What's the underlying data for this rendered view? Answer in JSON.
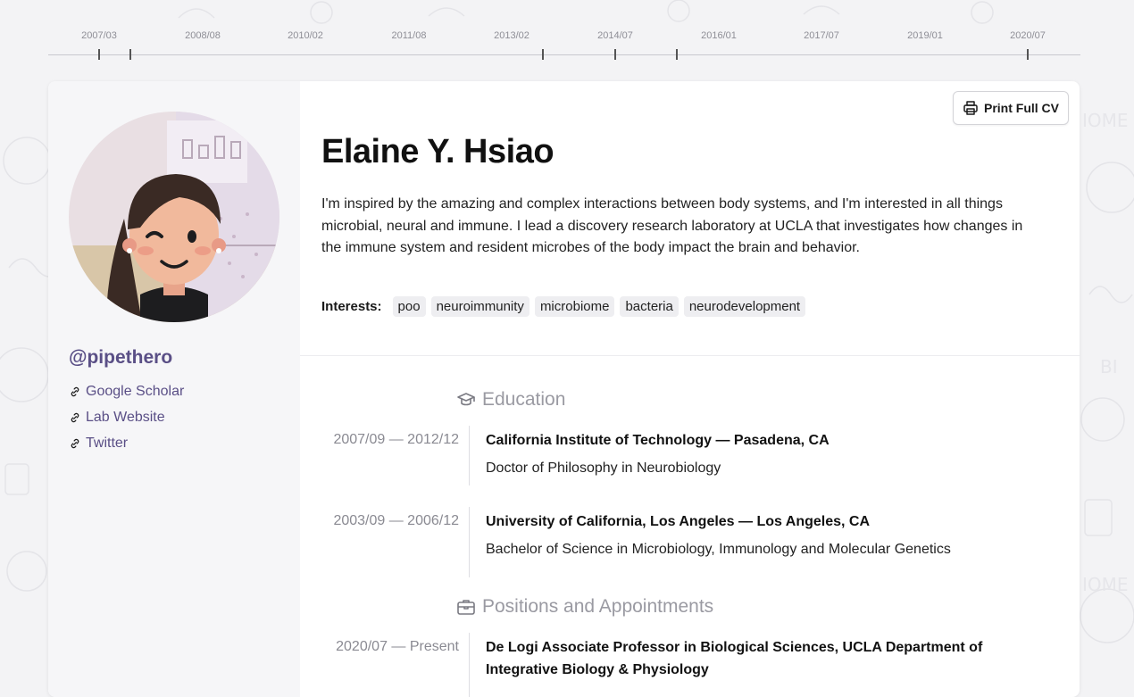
{
  "timeline": {
    "labels": [
      "2007/03",
      "2008/08",
      "2010/02",
      "2011/08",
      "2013/02",
      "2014/07",
      "2016/01",
      "2017/07",
      "2019/01",
      "2020/07"
    ]
  },
  "profile": {
    "handle": "@pipethero",
    "links": [
      {
        "label": "Google Scholar",
        "icon": "link-icon"
      },
      {
        "label": "Lab Website",
        "icon": "link-icon"
      },
      {
        "label": "Twitter",
        "icon": "link-icon"
      }
    ]
  },
  "header": {
    "print_label": "Print Full CV",
    "name": "Elaine Y. Hsiao",
    "bio": "I'm inspired by the amazing and complex interactions between body systems, and I'm interested in all things microbial, neural and immune. I lead a discovery research laboratory at UCLA that investigates how changes in the immune system and resident microbes of the body impact the brain and behavior.",
    "interests_label": "Interests:",
    "interests": [
      "poo",
      "neuroimmunity",
      "microbiome",
      "bacteria",
      "neurodevelopment"
    ]
  },
  "education": {
    "heading": "Education",
    "icon": "graduation-cap-icon",
    "entries": [
      {
        "date": "2007/09 — 2012/12",
        "title": "California Institute of Technology — Pasadena, CA",
        "sub": "Doctor of Philosophy in Neurobiology"
      },
      {
        "date": "2003/09 — 2006/12",
        "title": "University of California, Los Angeles — Los Angeles, CA",
        "sub": "Bachelor of Science in Microbiology, Immunology and Molecular Genetics"
      }
    ]
  },
  "positions": {
    "heading": "Positions and Appointments",
    "icon": "briefcase-icon",
    "entries": [
      {
        "date": "2020/07 — Present",
        "title": "De Logi Associate Professor in Biological Sciences, UCLA Department of Integrative Biology & Physiology"
      }
    ]
  },
  "colors": {
    "accent": "#5a4f86",
    "background": "#f3f3f5"
  }
}
